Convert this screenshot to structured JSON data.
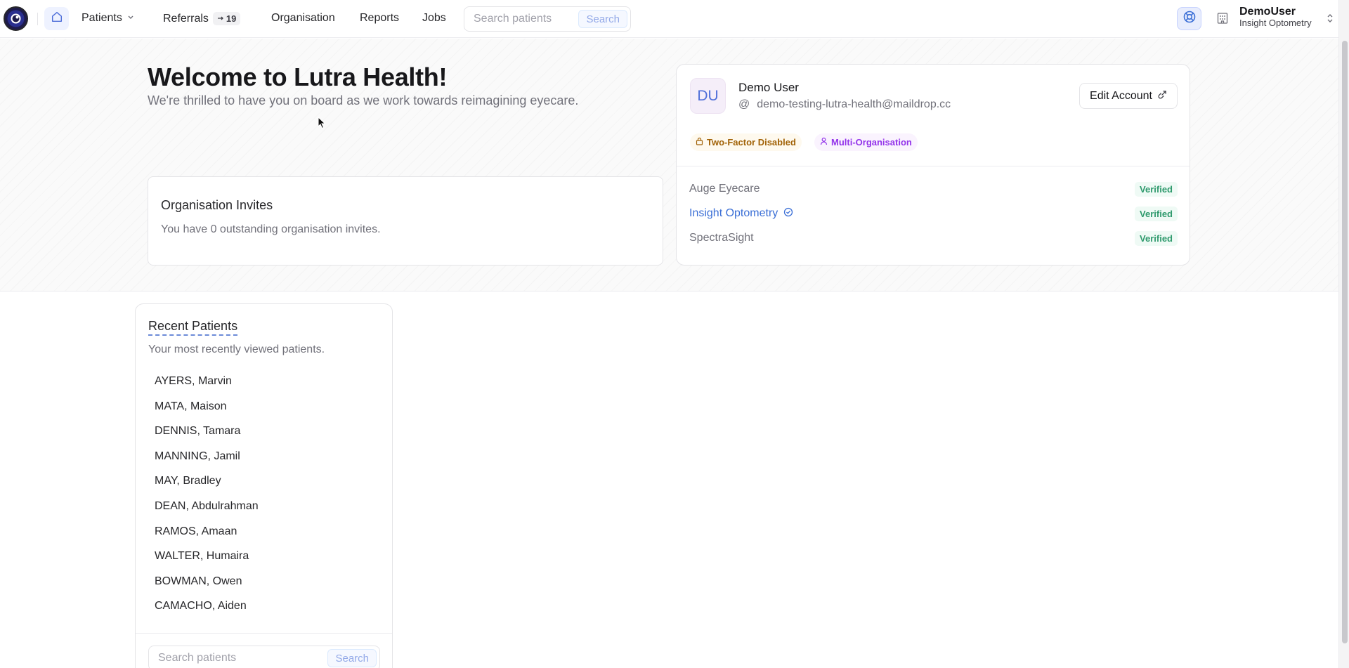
{
  "nav": {
    "patients_label": "Patients",
    "referrals_label": "Referrals",
    "referrals_count": "19",
    "organisation_label": "Organisation",
    "reports_label": "Reports",
    "jobs_label": "Jobs",
    "search_placeholder": "Search patients",
    "search_button": "Search",
    "user_name": "DemoUser",
    "user_org": "Insight Optometry"
  },
  "hero": {
    "title": "Welcome to Lutra Health!",
    "subtitle": "We're thrilled to have you on board as we work towards reimagining eyecare."
  },
  "invites": {
    "title": "Organisation Invites",
    "text": "You have 0 outstanding organisation invites."
  },
  "account": {
    "initials": "DU",
    "name": "Demo User",
    "email_prefix": "@",
    "email": "demo-testing-lutra-health@maildrop.cc",
    "edit_label": "Edit Account",
    "two_factor_label": "Two-Factor Disabled",
    "multi_org_label": "Multi-Organisation",
    "organisations": [
      {
        "name": "Auge Eyecare",
        "status": "Verified",
        "active": false
      },
      {
        "name": "Insight Optometry",
        "status": "Verified",
        "active": true
      },
      {
        "name": "SpectraSight",
        "status": "Verified",
        "active": false
      }
    ]
  },
  "recent": {
    "title": "Recent Patients",
    "subtitle": "Your most recently viewed patients.",
    "patients": [
      "AYERS, Marvin",
      "MATA, Maison",
      "DENNIS, Tamara",
      "MANNING, Jamil",
      "MAY, Bradley",
      "DEAN, Abdulrahman",
      "RAMOS, Amaan",
      "WALTER, Humaira",
      "BOWMAN, Owen",
      "CAMACHO, Aiden"
    ],
    "search_placeholder": "Search patients",
    "search_button": "Search"
  },
  "colors": {
    "accent": "#3b6fd6",
    "verified": "#2f9a6d",
    "warning": "#a16207",
    "multi_org": "#9333ea"
  },
  "icons": [
    "logo-icon",
    "home-icon",
    "chevron-down-icon",
    "arrow-right-icon",
    "help-icon",
    "building-icon",
    "chevron-updown-icon",
    "lock-icon",
    "user-icon",
    "external-link-icon",
    "check-badge-icon"
  ]
}
